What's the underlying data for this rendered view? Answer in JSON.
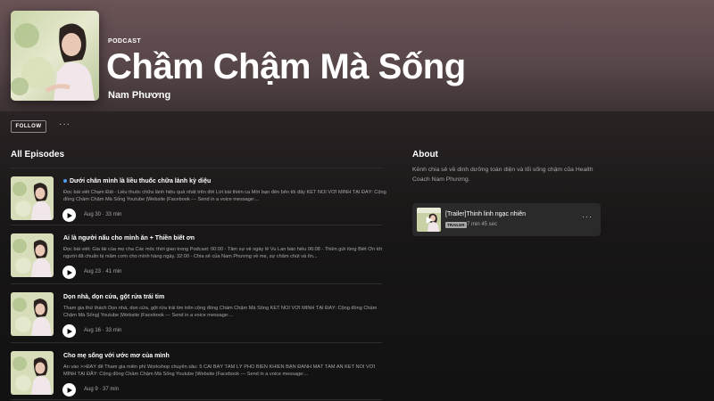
{
  "podcast": {
    "kicker": "PODCAST",
    "title": "Chầm Chậm Mà Sống",
    "author": "Nam Phương"
  },
  "actions": {
    "follow_label": "FOLLOW",
    "more_label": "···"
  },
  "episodes_section": {
    "title": "All Episodes",
    "items": [
      {
        "title": "Dưới chân mình là liều thuốc chữa lành kỳ diệu",
        "is_new": true,
        "description": "Đọc bài viết Chạm Đất - Liều thuốc chữa lành hiệu quả nhất trên đời Lời bài thiền ca Mời bạn đến bên tôi đây KẾT NỐI VỚI MÌNH TẠI ĐÂY: Cộng đồng Chầm Chậm Mà Sống Youtube |Website |Facebook --- Send in a voice message:...",
        "meta": "Aug 30 · 33 min"
      },
      {
        "title": "Ai là người nấu cho mình ăn + Thiền biết ơn",
        "is_new": false,
        "description": "Đọc bài viết: Gia tài của mẹ cha Các mốc thời gian trong Podcast: 00:00 - Tâm sự về ngày lễ Vu Lan báo hiếu  06:08 - Thiền gửi lòng Biết Ơn tới người đã chuẩn bị mâm cơm cho mình hàng ngày.  32:00 - Chia sẻ của Nam Phương về mẹ, sự chăm chút và tìn...",
        "meta": "Aug 23 · 41 min"
      },
      {
        "title": "Dọn nhà, dọn cửa, gột rửa trái tim",
        "is_new": false,
        "description": "Tham gia thử thách Dọn nhà, dọn cửa, gột rửa trái tim trên cộng đồng Chầm Chậm Mà Sống KẾT NỐI VỚI MÌNH TẠI ĐÂY: Cộng đồng Chầm Chậm Mà Sống| Youtube |Website |Facebook --- Send in a voice message:...",
        "meta": "Aug 16 · 33 min"
      },
      {
        "title": "Cho mẹ sống với ước mơ của mình",
        "is_new": false,
        "description": "Ấn vào >>ĐÂY để Tham gia miễn phí Workshop chuyên sâu: 5 CÁI BẪY TÂM LÝ PHỔ BIẾN KHIẾN BẠN ĐÁNH MẤT TÂM AN KẾT NỐI VỚI MÌNH TẠI ĐÂY: Cộng đồng Chầm Chậm Mà Sống Youtube |Website |Facebook --- Send in a voice message:...",
        "meta": "Aug 9 · 37 min"
      }
    ]
  },
  "about": {
    "title": "About",
    "text": "Kênh chia sẻ về dinh dưỡng toàn diện và lối sống chậm của Health Coach Nam Phương.",
    "trailer": {
      "title": "[Trailer]Thinh linh ngạc nhiên",
      "badge": "TRAILER",
      "duration": "7 min 45 sec",
      "more_label": "···"
    }
  },
  "colors": {
    "header_top": "#6b5457",
    "background": "#121212",
    "new_dot": "#509bf5",
    "muted_text": "#a7a7a7"
  }
}
